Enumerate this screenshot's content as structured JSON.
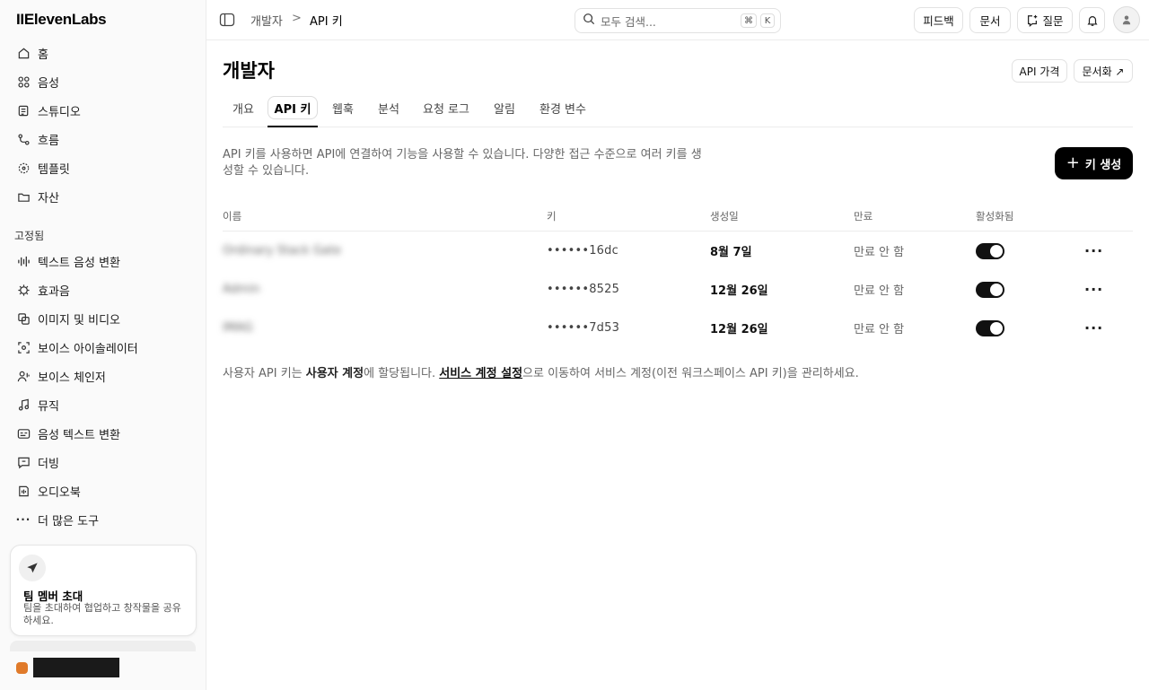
{
  "sidebar": {
    "logo": "IIElevenLabs",
    "nav_top": [
      {
        "label": "홈",
        "icon": "home-icon"
      },
      {
        "label": "음성",
        "icon": "voices-icon"
      },
      {
        "label": "스튜디오",
        "icon": "studio-icon"
      },
      {
        "label": "흐름",
        "icon": "flows-icon"
      },
      {
        "label": "템플릿",
        "icon": "templates-icon"
      },
      {
        "label": "자산",
        "icon": "folder-icon"
      }
    ],
    "pinned_label": "고정됨",
    "nav_pinned": [
      {
        "label": "텍스트 음성 변환",
        "icon": "waveform-icon"
      },
      {
        "label": "효과음",
        "icon": "sound-effects-icon"
      },
      {
        "label": "이미지 및 비디오",
        "icon": "image-video-icon"
      },
      {
        "label": "보이스 아이솔레이터",
        "icon": "voice-isolator-icon"
      },
      {
        "label": "보이스 체인저",
        "icon": "voice-changer-icon"
      },
      {
        "label": "뮤직",
        "icon": "music-icon"
      },
      {
        "label": "음성 텍스트 변환",
        "icon": "speech-to-text-icon"
      },
      {
        "label": "더빙",
        "icon": "dubbing-icon"
      },
      {
        "label": "오디오북",
        "icon": "audiobook-icon"
      },
      {
        "label": "더 많은 도구",
        "icon": "more-icon"
      }
    ],
    "invite": {
      "title": "팀 멤버 초대",
      "desc": "팀을 초대하여 협업하고 창작물을 공유하세요."
    }
  },
  "topbar": {
    "crumb_parent": "개발자",
    "crumb_sep": ">",
    "crumb_current": "API 키",
    "search_placeholder": "모두 검색...",
    "search_kbd1": "⌘",
    "search_kbd2": "K",
    "feedback": "피드백",
    "docs": "문서",
    "ask": "질문"
  },
  "page": {
    "title": "개발자",
    "api_pricing": "API 가격",
    "documentation": "문서화 ↗",
    "tabs": [
      "개요",
      "API 키",
      "웹훅",
      "분석",
      "요청 로그",
      "알림",
      "환경 변수"
    ],
    "active_tab": 1,
    "description": "API 키를 사용하면 API에 연결하여 기능을 사용할 수 있습니다. 다양한 접근 수준으로 여러 키를 생성할 수 있습니다.",
    "create_key": "키 생성"
  },
  "table": {
    "headers": {
      "name": "이름",
      "key": "키",
      "created": "생성일",
      "expiry": "만료",
      "enabled": "활성화됨"
    },
    "rows": [
      {
        "name": "Ordinary Stack Gate",
        "key": "••••••16dc",
        "created": "8월 7일",
        "expiry": "만료 안 함",
        "enabled": true
      },
      {
        "name": "Admin",
        "key": "••••••8525",
        "created": "12월 26일",
        "expiry": "만료 안 함",
        "enabled": true
      },
      {
        "name": "IMAG",
        "key": "••••••7d53",
        "created": "12월 26일",
        "expiry": "만료 안 함",
        "enabled": true
      }
    ]
  },
  "footnote": {
    "p1": "사용자 API 키는 ",
    "b1": "사용자 계정",
    "p2": "에 할당됩니다. ",
    "link": "서비스 계정 설정",
    "p3": "으로 이동하여 서비스 계정(이전 워크스페이스 API 키)을 관리하세요."
  }
}
